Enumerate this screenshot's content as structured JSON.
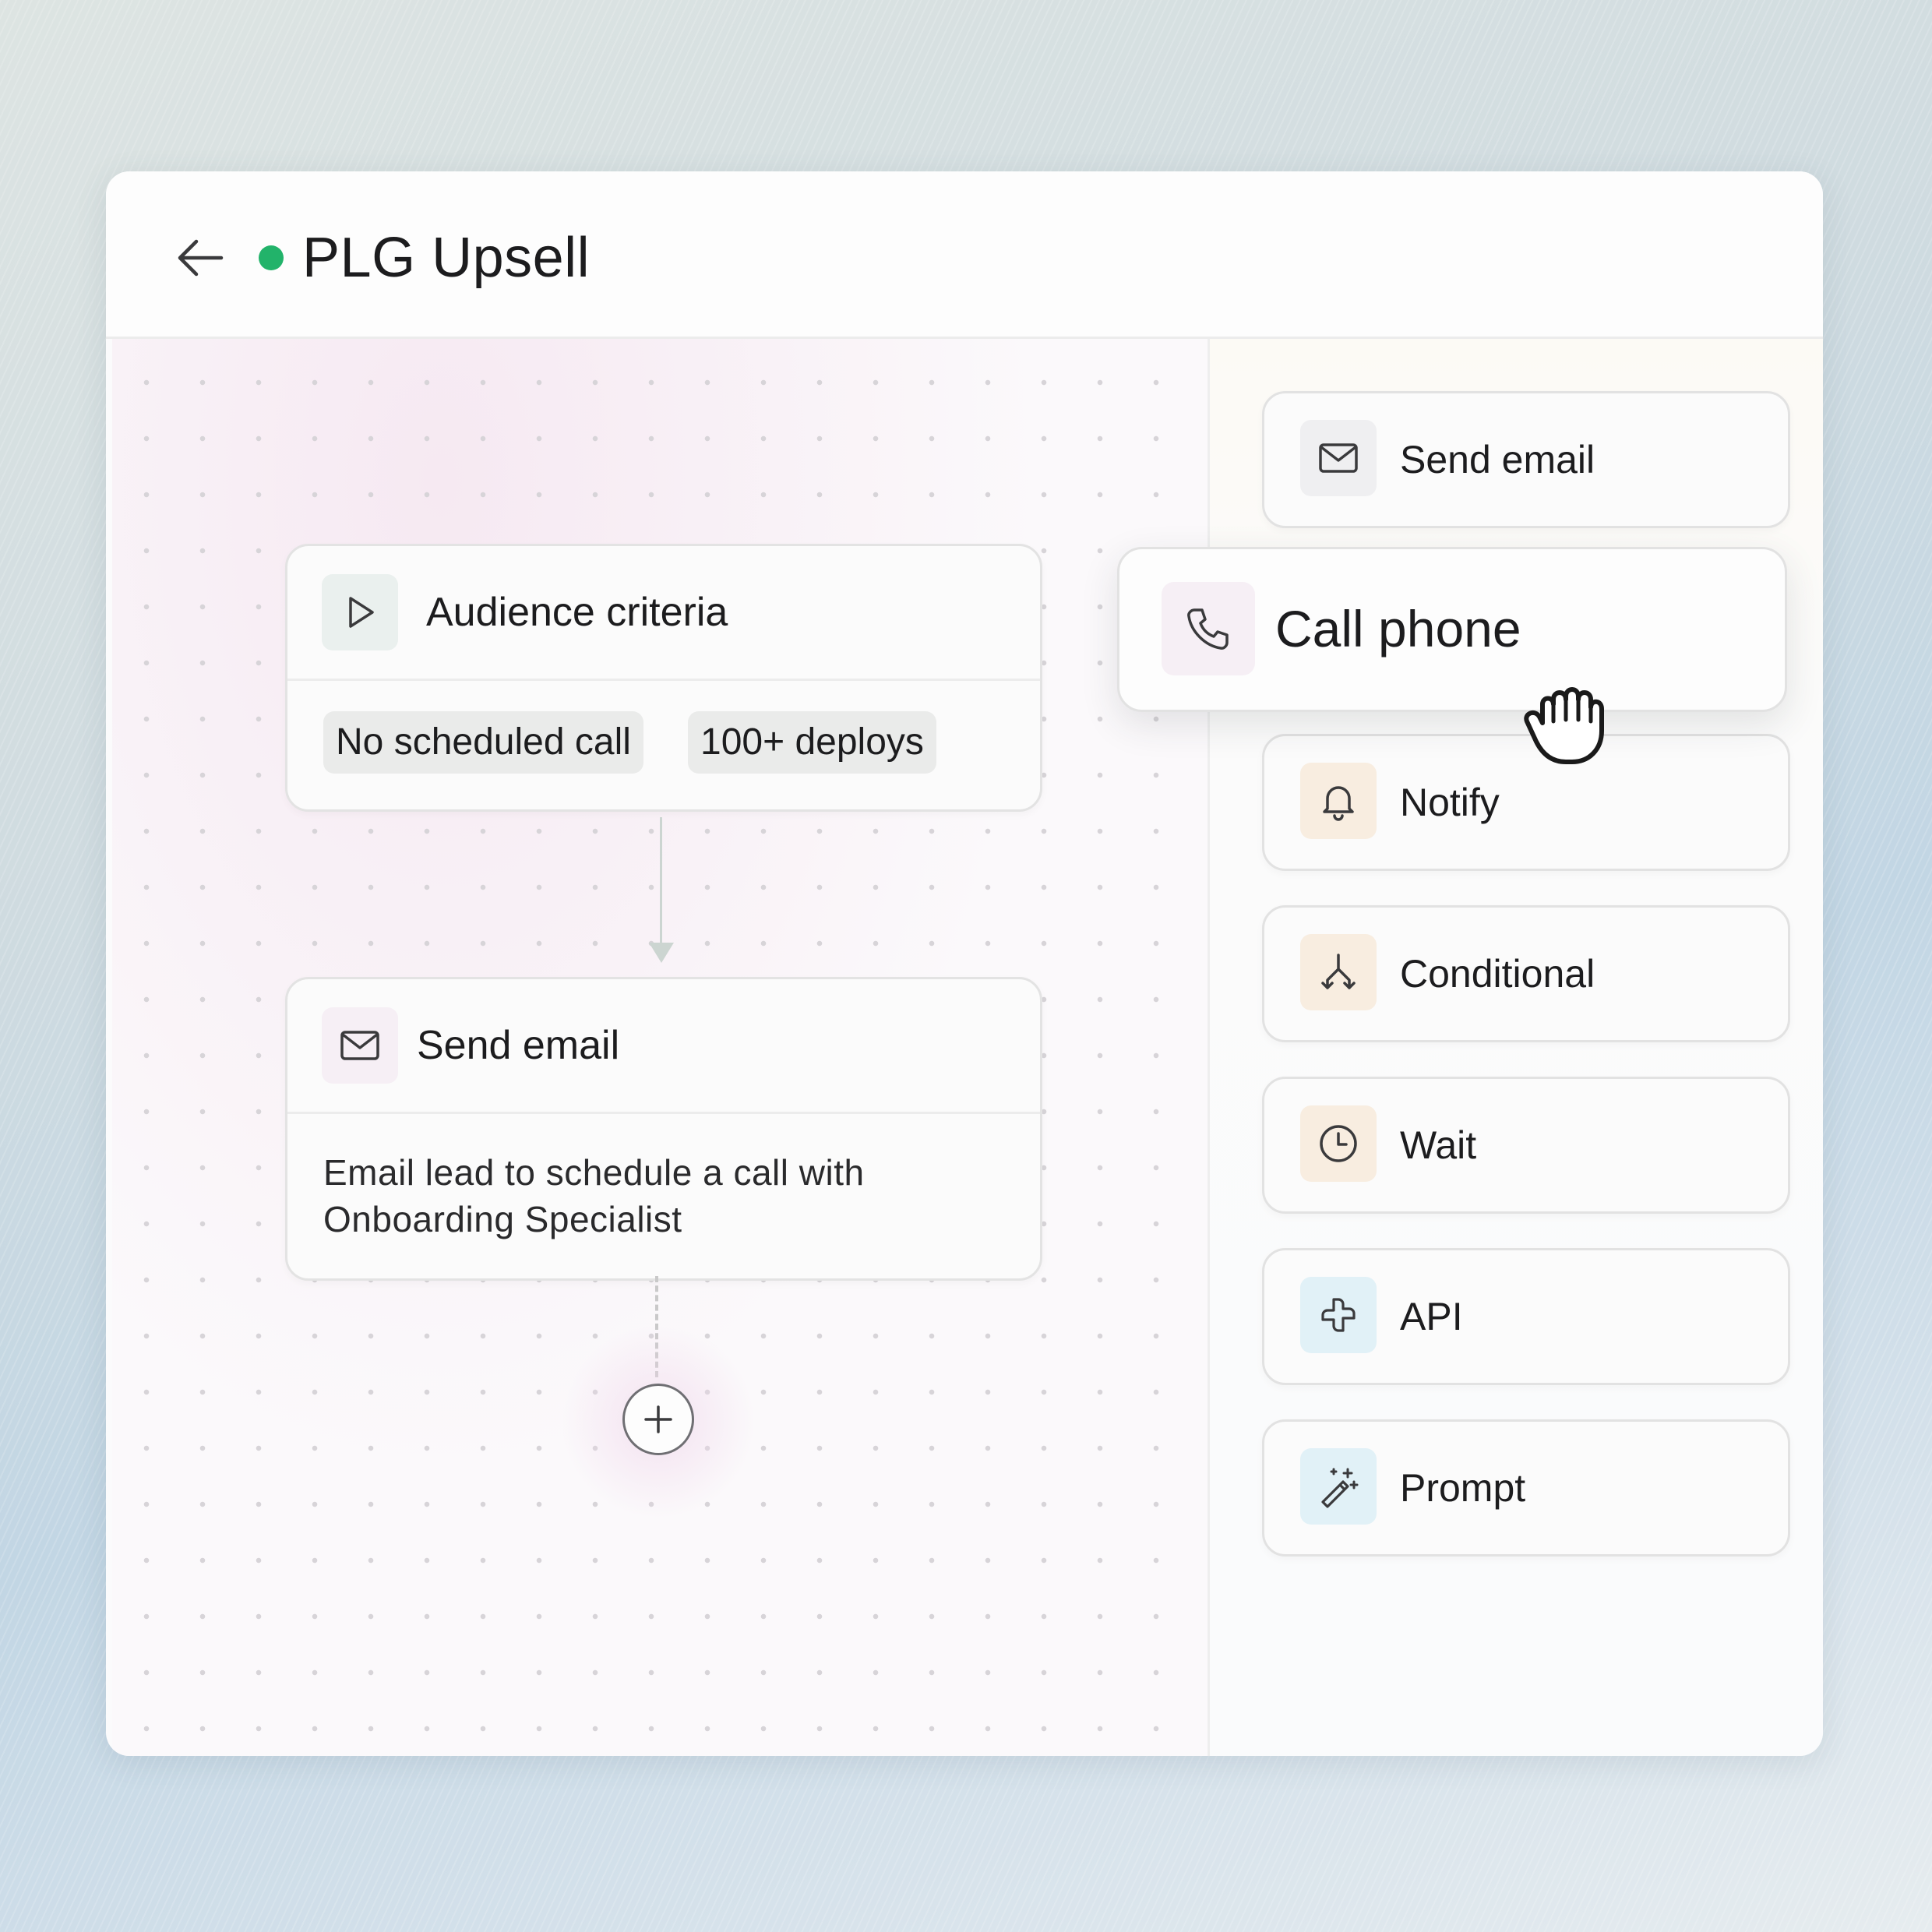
{
  "header": {
    "title": "PLG Upsell",
    "back_icon": "arrow-left-icon",
    "status_color": "#22b36a"
  },
  "workflow": {
    "nodes": [
      {
        "title": "Audience criteria",
        "icon": "play-icon",
        "tags": [
          "No scheduled call",
          "100+ deploys"
        ]
      },
      {
        "title": "Send email",
        "icon": "mail-icon",
        "description_lines": [
          "Email lead to schedule a call with",
          "Onboarding Specialist"
        ]
      }
    ],
    "add_step_icon": "plus-icon"
  },
  "dragging": {
    "label": "Call phone",
    "icon": "phone-icon",
    "cursor": "grab-hand-icon"
  },
  "actions": [
    {
      "label": "Send email",
      "icon": "mail-icon"
    },
    {
      "label": "Notify",
      "icon": "bell-icon"
    },
    {
      "label": "Conditional",
      "icon": "split-icon"
    },
    {
      "label": "Wait",
      "icon": "clock-icon"
    },
    {
      "label": "API",
      "icon": "api-icon"
    },
    {
      "label": "Prompt",
      "icon": "magic-wand-icon"
    }
  ]
}
